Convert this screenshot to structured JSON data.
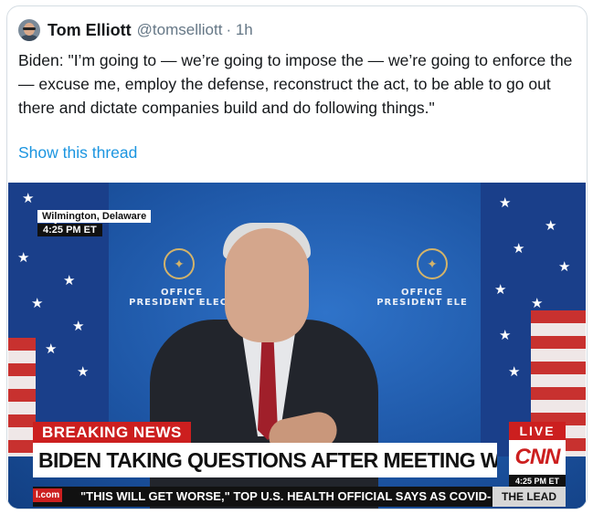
{
  "tweet": {
    "author_name": "Tom Elliott",
    "author_handle": "@tomselliott",
    "time": "· 1h",
    "text": "Biden: \"I’m going to — we’re going to impose the — we’re going to enforce the — excuse me, employ the defense, reconstruct the act, to be able to go out there and dictate companies build and do following things.\"",
    "show_thread": "Show this thread"
  },
  "video": {
    "location": "Wilmington, Delaware",
    "time": "4:25 PM ET",
    "office_line1": "OFFICE",
    "office_line2_left": "PRESIDENT ELECT",
    "office_line2_right": "PRESIDENT ELE",
    "breaking": "BREAKING NEWS",
    "headline": "BIDEN TAKING QUESTIONS AFTER MEETING WITH GOVERNORS",
    "live": "LIVE",
    "network": "CNN",
    "network_time": "4:25 PM ET",
    "ticker_tag": "l.com",
    "ticker_text": "\"THIS WILL GET WORSE,\" TOP U.S. HEALTH OFFICIAL SAYS AS COVID-",
    "ticker_show": "THE LEAD"
  }
}
